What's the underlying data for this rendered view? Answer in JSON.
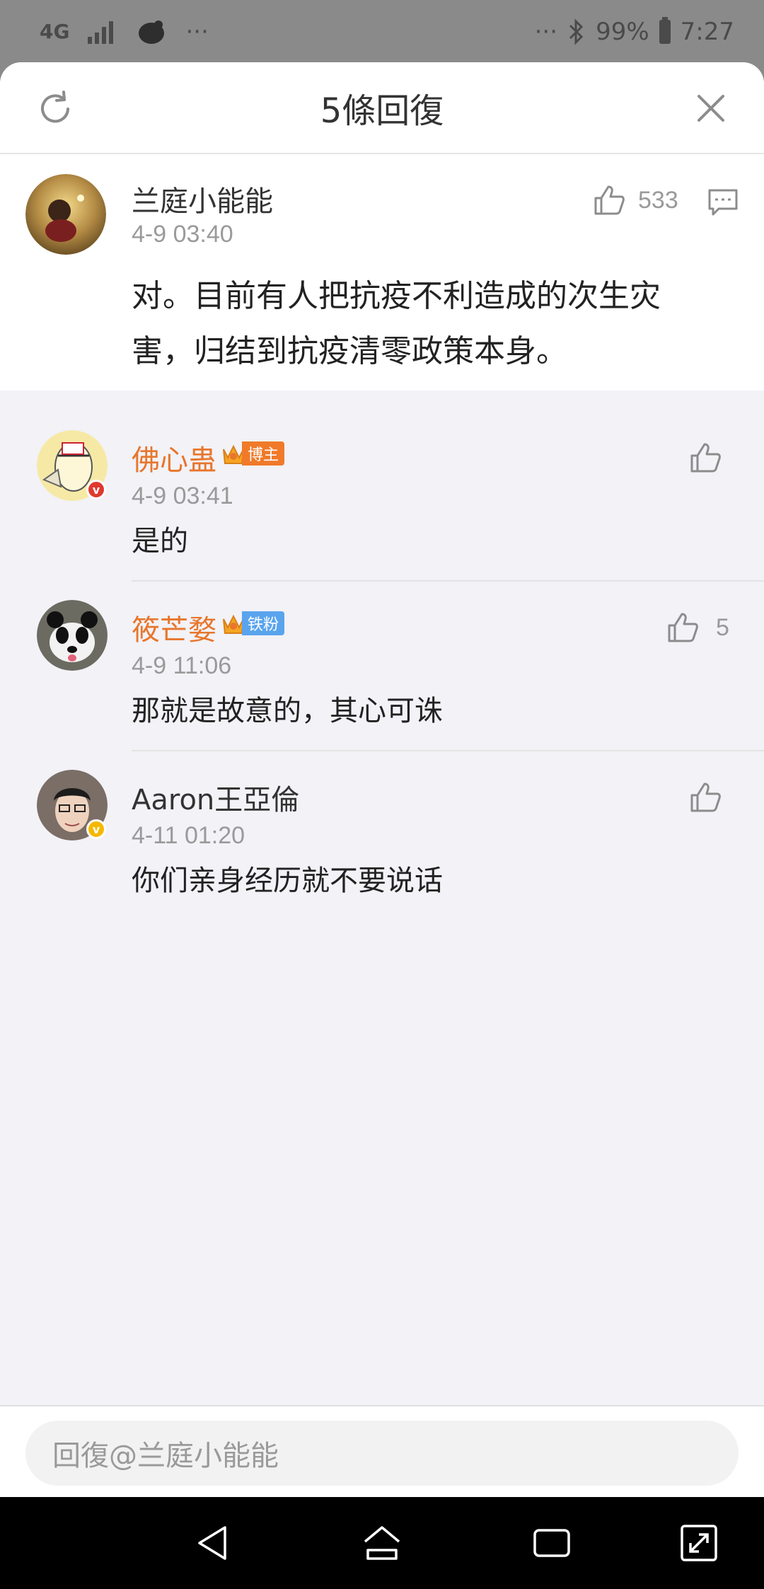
{
  "status_bar": {
    "network": "4G",
    "battery": "99%",
    "time": "7:27",
    "left_more": "···",
    "right_more": "···"
  },
  "sheet": {
    "title": "5條回復",
    "icons": {
      "refresh": "refresh-icon",
      "close": "close-icon"
    }
  },
  "main_comment": {
    "user": "兰庭小能能",
    "time": "4-9 03:40",
    "likes": "533",
    "text_line1": "对。目前有人把抗疫不利造成的次生灾",
    "text_line2": "害，归结到抗疫清零政策本身。"
  },
  "replies": [
    {
      "user": "佛心蛊",
      "badge": "博主",
      "time": "4-9 03:41",
      "text": "是的",
      "likes": ""
    },
    {
      "user": "筱芒婺",
      "badge": "铁粉",
      "time": "4-9 11:06",
      "text": "那就是故意的，其心可诛",
      "likes": "5"
    },
    {
      "user": "Aaron王亞倫",
      "badge": "",
      "time": "4-11 01:20",
      "text": "你们亲身经历就不要说话",
      "likes": ""
    }
  ],
  "input": {
    "placeholder": "回復@兰庭小能能"
  },
  "colors": {
    "accent_orange": "#e8762c",
    "badge_blogger": "#f07a2a",
    "badge_fan": "#5aa4ee",
    "verified_red": "#e0382f",
    "verified_gold": "#f5b800"
  }
}
